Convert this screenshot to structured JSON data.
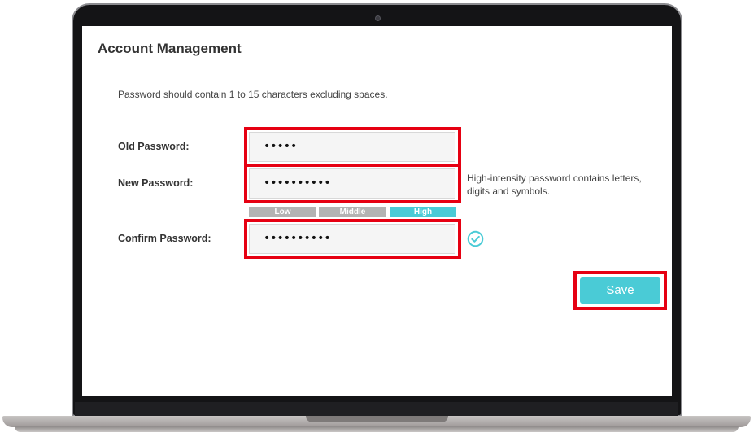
{
  "page": {
    "title": "Account Management",
    "hint": "Password should contain 1 to 15 characters excluding spaces."
  },
  "form": {
    "old_password": {
      "label": "Old Password:",
      "value": "•••••"
    },
    "new_password": {
      "label": "New Password:",
      "value": "••••••••••"
    },
    "confirm_password": {
      "label": "Confirm Password:",
      "value": "••••••••••"
    },
    "strength_note": "High-intensity password contains letters, digits and symbols.",
    "strength_levels": [
      "Low",
      "Middle",
      "High"
    ],
    "strength_active": "High",
    "save_label": "Save"
  },
  "colors": {
    "accent": "#4acbd6",
    "highlight": "#e60012",
    "inactive_strength": "#b3b3b3"
  }
}
